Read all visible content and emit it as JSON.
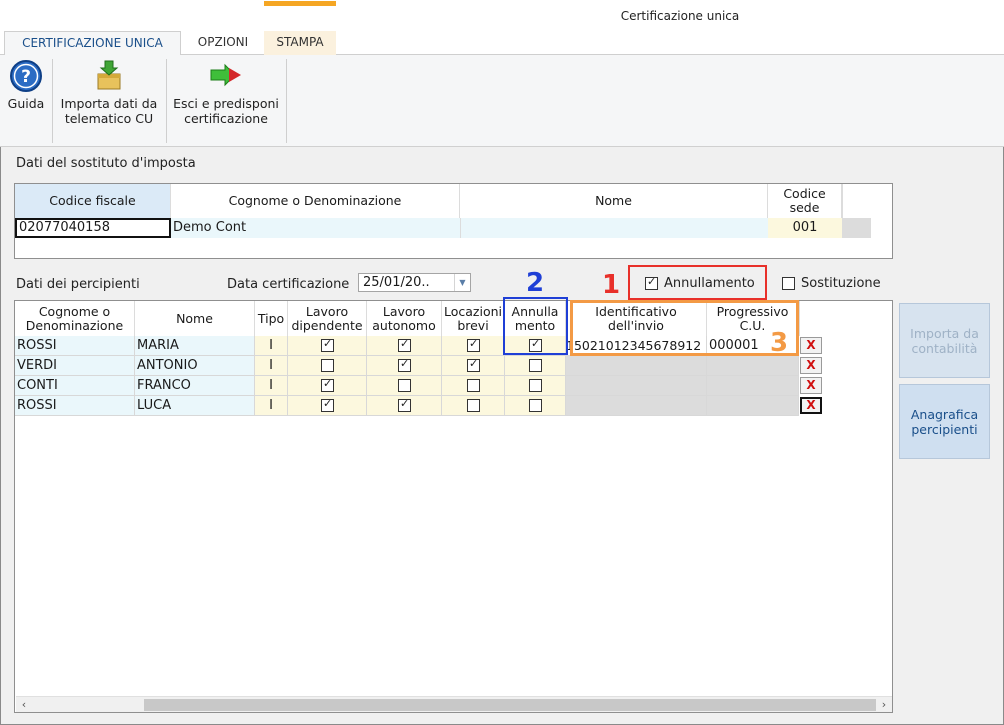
{
  "window": {
    "title": "Certificazione unica"
  },
  "tabs": [
    "CERTIFICAZIONE UNICA",
    "OPZIONI",
    "STAMPA"
  ],
  "ribbon": {
    "guida": "Guida",
    "importa_line1": "Importa dati da",
    "importa_line2": "telematico CU",
    "esci_line1": "Esci e predisponi",
    "esci_line2": "certificazione"
  },
  "sostituto": {
    "label": "Dati del sostituto d'imposta",
    "headers": {
      "cf": "Codice fiscale",
      "cognome": "Cognome o Denominazione",
      "nome": "Nome",
      "sede_line1": "Codice",
      "sede_line2": "sede"
    },
    "values": {
      "cf": "02077040158",
      "cognome": "Demo Cont",
      "nome": "",
      "sede": "001"
    }
  },
  "percipienti": {
    "label": "Dati dei percipienti",
    "data_label": "Data certificazione",
    "data_value": "25/01/20..",
    "annullamento_label": "Annullamento",
    "annullamento_checked": true,
    "sostituzione_label": "Sostituzione",
    "sostituzione_checked": false,
    "headers": {
      "cognome_l1": "Cognome o",
      "cognome_l2": "Denominazione",
      "nome": "Nome",
      "tipo": "Tipo",
      "lavdip_l1": "Lavoro",
      "lavdip_l2": "dipendente",
      "lavaut_l1": "Lavoro",
      "lavaut_l2": "autonomo",
      "loc_l1": "Locazioni",
      "loc_l2": "brevi",
      "ann_l1": "Annulla",
      "ann_l2": "mento",
      "ident_l1": "Identificativo",
      "ident_l2": "dell'invio",
      "prog_l1": "Progressivo",
      "prog_l2": "C.U."
    },
    "rows": [
      {
        "cognome": "ROSSI",
        "nome": "MARIA",
        "tipo": "I",
        "dip": true,
        "aut": true,
        "loc": true,
        "ann": true,
        "ident": "15021012345678912",
        "prog": "000001",
        "x": "X"
      },
      {
        "cognome": "VERDI",
        "nome": "ANTONIO",
        "tipo": "I",
        "dip": false,
        "aut": true,
        "loc": true,
        "ann": false,
        "ident": "",
        "prog": "",
        "x": "X"
      },
      {
        "cognome": "CONTI",
        "nome": "FRANCO",
        "tipo": "I",
        "dip": true,
        "aut": false,
        "loc": false,
        "ann": false,
        "ident": "",
        "prog": "",
        "x": "X"
      },
      {
        "cognome": "ROSSI",
        "nome": "LUCA",
        "tipo": "I",
        "dip": true,
        "aut": true,
        "loc": false,
        "ann": false,
        "ident": "",
        "prog": "",
        "x": "X"
      }
    ]
  },
  "side_buttons": {
    "importa_l1": "Importa da",
    "importa_l2": "contabilità",
    "anagrafica_l1": "Anagrafica",
    "anagrafica_l2": "percipienti"
  },
  "annotations": {
    "n1": "1",
    "n2": "2",
    "n3": "3"
  },
  "colors": {
    "red": "#e8302a",
    "blue": "#1f3fd6",
    "orange": "#f39a45",
    "accent": "#f5a623"
  }
}
